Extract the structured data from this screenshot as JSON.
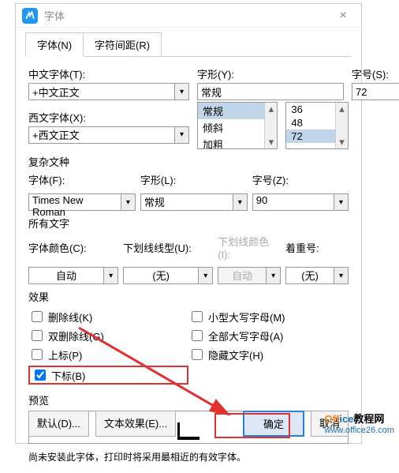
{
  "window": {
    "title": "字体",
    "close": "×"
  },
  "tabs": {
    "font": "字体(N)",
    "spacing": "字符间距(R)"
  },
  "cn": {
    "label": "中文字体(T):",
    "value": "+中文正文",
    "style_label": "字形(Y):",
    "style_value": "常规",
    "size_label": "字号(S):",
    "size_value": "72",
    "styles": [
      "常规",
      "倾斜",
      "加粗"
    ],
    "sizes": [
      "36",
      "48",
      "72"
    ]
  },
  "en": {
    "label": "西文字体(X):",
    "value": "+西文正文"
  },
  "complex": {
    "title": "复杂文种",
    "font_label": "字体(F):",
    "font_value": "Times New Roman",
    "style_label": "字形(L):",
    "style_value": "常规",
    "size_label": "字号(Z):",
    "size_value": "90"
  },
  "all": {
    "title": "所有文字",
    "color_label": "字体颜色(C):",
    "color_value": "自动",
    "ul_label": "下划线线型(U):",
    "ul_value": "(无)",
    "ulc_label": "下划线颜色(I):",
    "ulc_value": "自动",
    "em_label": "着重号:",
    "em_value": "(无)"
  },
  "effects": {
    "title": "效果",
    "strike": "删除线(K)",
    "dblstrike": "双删除线(G)",
    "sup": "上标(P)",
    "sub": "下标(B)",
    "smallcaps": "小型大写字母(M)",
    "allcaps": "全部大写字母(A)",
    "hidden": "隐藏文字(H)"
  },
  "preview": {
    "title": "预览",
    "note": "尚未安装此字体，打印时将采用最相近的有效字体。"
  },
  "footer": {
    "default": "默认(D)...",
    "textfx": "文本效果(E)...",
    "ok": "确定",
    "cancel": "取消"
  },
  "watermark": {
    "brand1": "Off",
    "brand2": "ice",
    "brand3": "教程网",
    "url": "www.office26.com"
  },
  "glyphs": {
    "chev": "▾",
    "up": "▴",
    "down": "▾"
  }
}
